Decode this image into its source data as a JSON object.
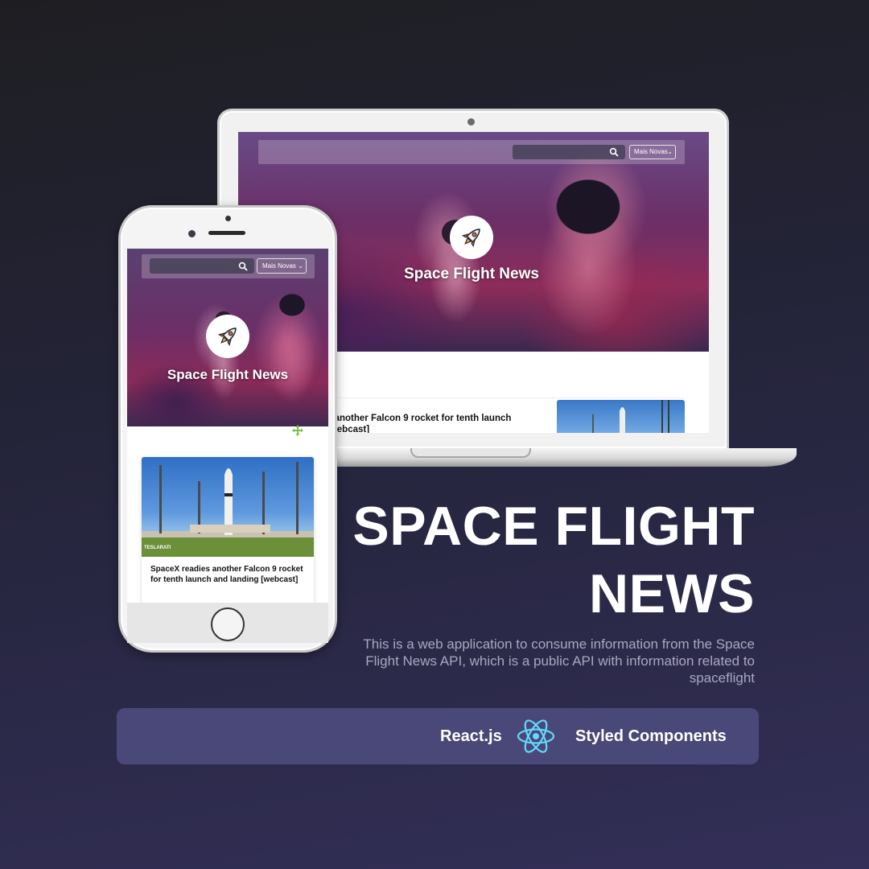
{
  "colors": {
    "background_top": "#1e1e22",
    "background_bottom": "#332f58",
    "tech_bar": "#4a4878",
    "react_blue": "#61dafb",
    "headline": "#ffffff",
    "description": "#a8a8bf"
  },
  "laptop": {
    "app": {
      "title": "Space Flight News",
      "sort_select_value": "Mais Novas",
      "search_icon": "search-icon",
      "logo_icon": "rocket-icon"
    },
    "article": {
      "title_visible": "s another Falcon 9 rocket for tenth launch [webcast]"
    }
  },
  "phone": {
    "app": {
      "title": "Space Flight News",
      "sort_select_value": "Mais Novas",
      "search_icon": "search-icon",
      "logo_icon": "rocket-icon"
    },
    "article": {
      "title": "SpaceX readies another Falcon 9 rocket for tenth launch and landing [webcast]",
      "image_watermark": "TESLARATI"
    }
  },
  "headline": {
    "line1": "SPACE FLIGHT",
    "line2": "NEWS"
  },
  "description": "This is a web application to consume  information from the Space Flight News API, which is  a public API with information related to spaceflight",
  "tech_stack": {
    "first": "React.js",
    "icon": "react-icon",
    "second": "Styled Components"
  }
}
